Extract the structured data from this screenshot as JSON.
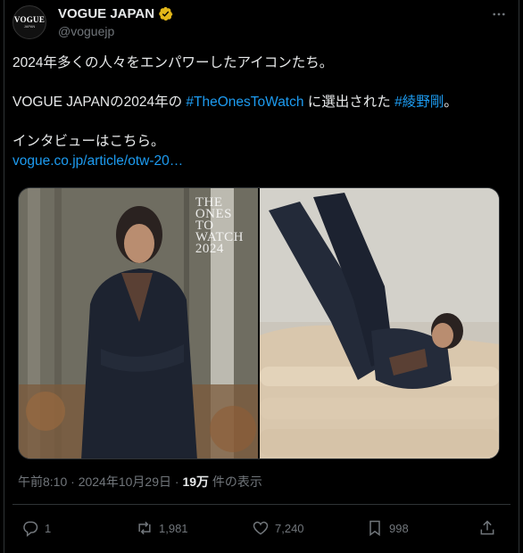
{
  "account": {
    "name": "VOGUE JAPAN",
    "handle": "@voguejp",
    "avatar_logo": "VOGUE",
    "avatar_sub": "JAPAN",
    "verified_color": "#e2b719"
  },
  "tweet": {
    "line1": "2024年多くの人々をエンパワーしたアイコンたち。",
    "line2_prefix": "VOGUE JAPANの2024年の ",
    "hashtag1": "#TheOnesToWatch",
    "line2_mid": " に選出された ",
    "hashtag2": "#綾野剛",
    "line2_suffix": "。",
    "line3": "インタビューはこちら。",
    "link": "vogue.co.jp/article/otw-20…",
    "link_color": "#1d9bf0"
  },
  "media": {
    "cover_lines": [
      "THE",
      "ONES",
      "TO",
      "WATCH",
      "2024"
    ],
    "left_icon": "forest-portrait-photo",
    "right_icon": "sofa-pose-photo"
  },
  "meta": {
    "time": "午前8:10",
    "separator": " · ",
    "date": "2024年10月29日",
    "views_count": "19万",
    "views_label": "件の表示"
  },
  "actions": {
    "replies": "1",
    "retweets": "1,981",
    "likes": "7,240",
    "bookmarks": "998"
  }
}
